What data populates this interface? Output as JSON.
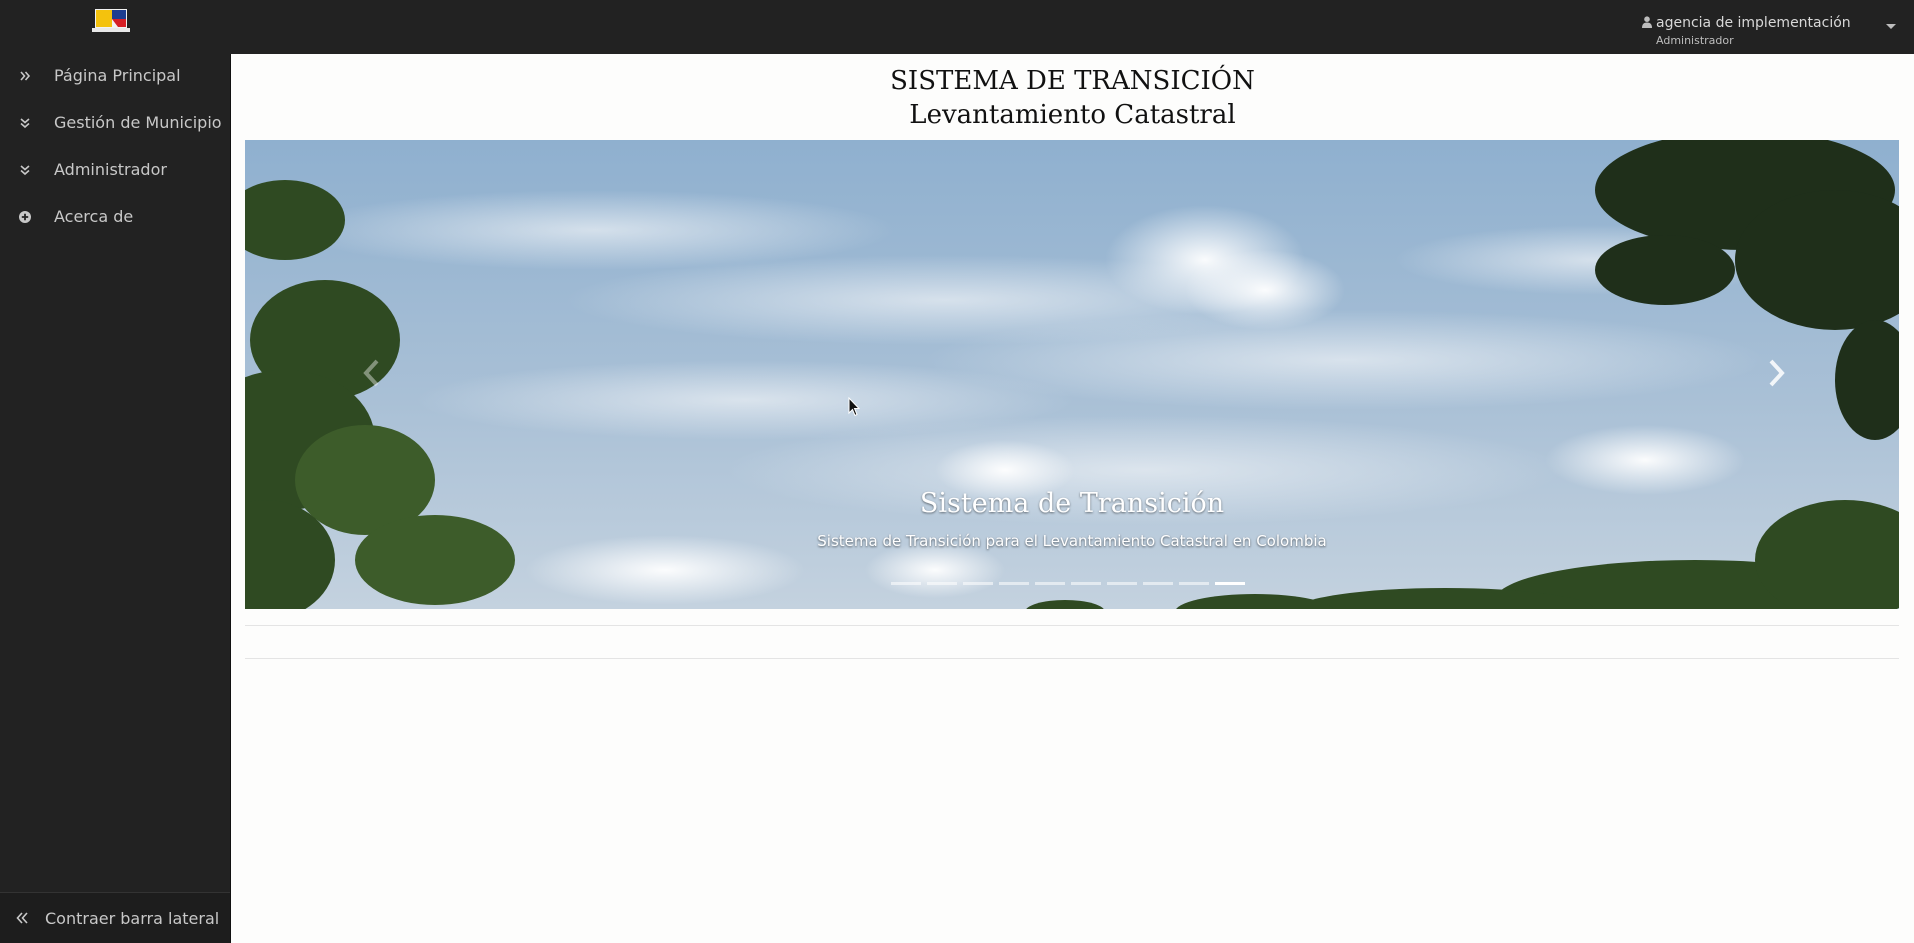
{
  "header": {
    "user_name": "agencia de implementación",
    "user_role": "Administrador"
  },
  "sidebar": {
    "items": [
      {
        "label": "Página Principal",
        "icon": "double-chevron-right-icon"
      },
      {
        "label": "Gestión de Municipio",
        "icon": "double-chevron-down-icon"
      },
      {
        "label": "Administrador",
        "icon": "double-chevron-down-icon"
      },
      {
        "label": "Acerca de",
        "icon": "plus-circle-icon"
      }
    ],
    "collapse_label": "Contraer barra lateral"
  },
  "main": {
    "title_line1": "SISTEMA DE TRANSICIÓN",
    "title_line2": "Levantamiento Catastral"
  },
  "carousel": {
    "caption_title": "Sistema de Transición",
    "caption_subtitle": "Sistema de Transición para el Levantamiento Catastral en Colombia",
    "slide_count": 10,
    "active_index": 9
  },
  "colors": {
    "topbar": "#222222",
    "sidebar": "#222222",
    "page_background": "#fdfdfc",
    "sky": "#a9c0d6"
  }
}
